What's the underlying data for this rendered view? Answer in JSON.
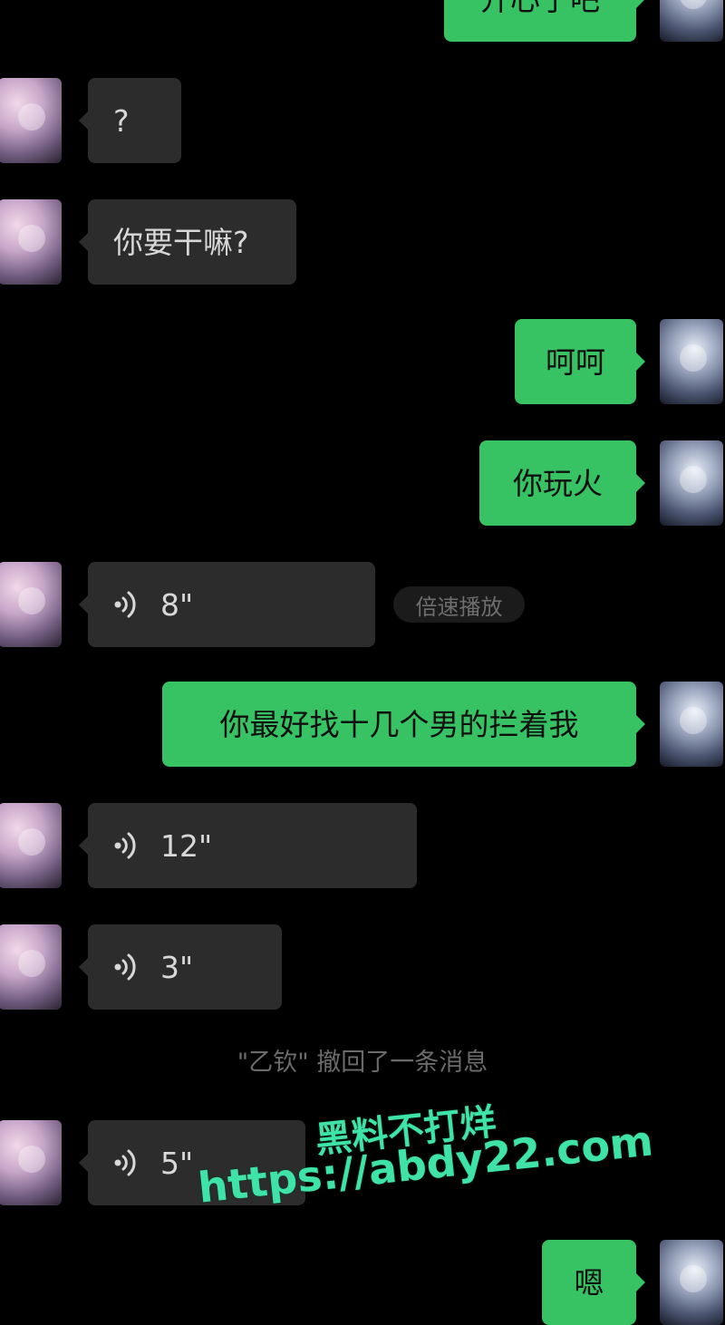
{
  "messages": [
    {
      "side": "self",
      "type": "text",
      "text": "开心了吧"
    },
    {
      "side": "peer",
      "type": "text",
      "text": "?"
    },
    {
      "side": "peer",
      "type": "text",
      "text": "你要干嘛?"
    },
    {
      "side": "self",
      "type": "text",
      "text": "呵呵"
    },
    {
      "side": "self",
      "type": "text",
      "text": "你玩火"
    },
    {
      "side": "peer",
      "type": "voice",
      "duration": "8\"",
      "speed_label": "倍速播放"
    },
    {
      "side": "self",
      "type": "text",
      "text": "你最好找十几个男的拦着我"
    },
    {
      "side": "peer",
      "type": "voice",
      "duration": "12\""
    },
    {
      "side": "peer",
      "type": "voice",
      "duration": "3\""
    },
    {
      "side": "system",
      "type": "recall",
      "text": "\"乙钦\" 撤回了一条消息"
    },
    {
      "side": "peer",
      "type": "voice",
      "duration": "5\""
    },
    {
      "side": "self",
      "type": "text",
      "text": "嗯"
    }
  ],
  "watermark": {
    "line1": "黑料不打烊",
    "line2": "https://abdy22.com"
  },
  "colors": {
    "background": "#000000",
    "self_bubble": "#37c264",
    "peer_bubble": "#2c2c2c",
    "watermark": "#3fe3a7"
  },
  "icons": {
    "voice": "voice-wave-icon",
    "avatar_peer": "anime-girl-avatar",
    "avatar_self": "anime-boy-avatar"
  }
}
